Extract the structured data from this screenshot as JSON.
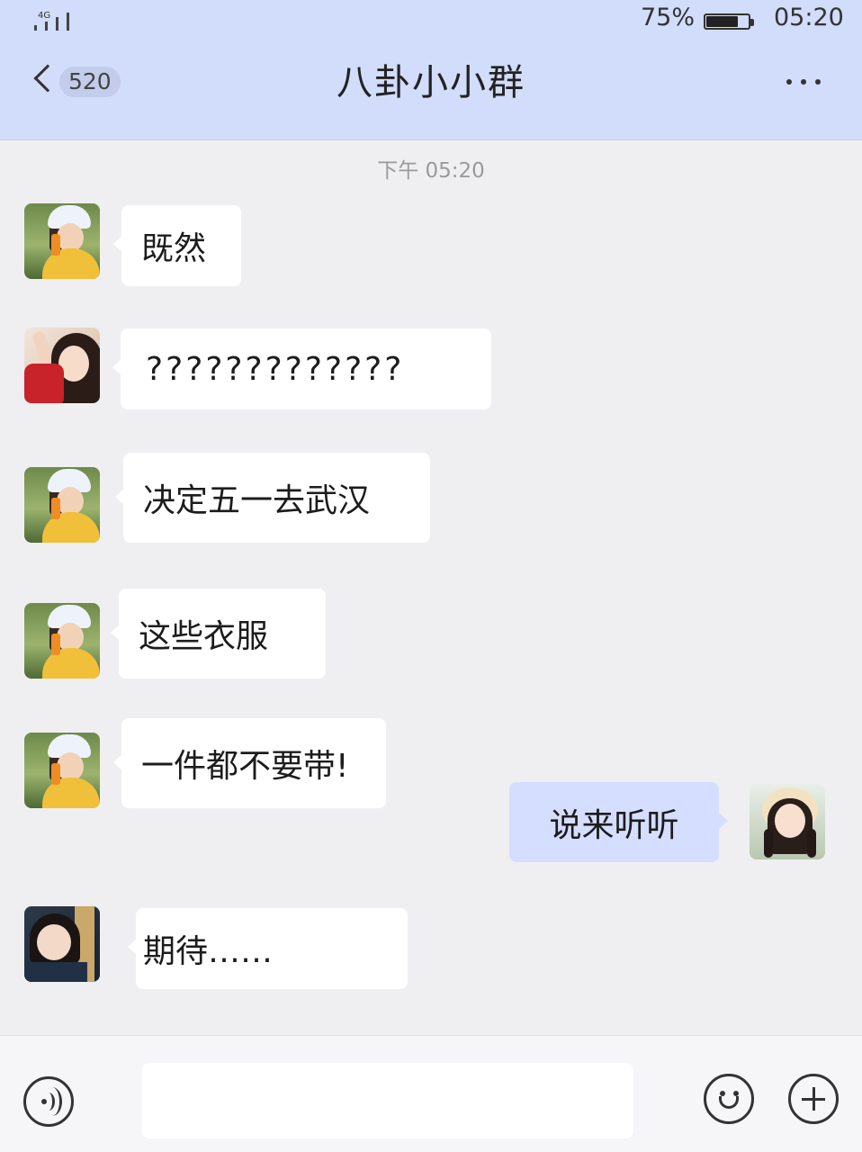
{
  "status_bar": {
    "network": "4G",
    "battery_percent": "75%",
    "battery_level": 0.75,
    "time": "05:20"
  },
  "header": {
    "back_count": "520",
    "title": "八卦小小群",
    "more_icon": "more-dots-icon"
  },
  "chat": {
    "timestamp": "下午 05:20",
    "messages": [
      {
        "sender": "other",
        "avatar": "girl-bucket-hat-avatar",
        "text": "既然"
      },
      {
        "sender": "other",
        "avatar": "girl-red-dress-avatar",
        "text": "?????????????"
      },
      {
        "sender": "other",
        "avatar": "girl-bucket-hat-avatar",
        "text": "决定五一去武汉"
      },
      {
        "sender": "other",
        "avatar": "girl-bucket-hat-avatar",
        "text": "这些衣服"
      },
      {
        "sender": "other",
        "avatar": "girl-bucket-hat-avatar",
        "text": "一件都不要带!"
      },
      {
        "sender": "self",
        "avatar": "girl-straw-hat-avatar",
        "text": "说来听听"
      },
      {
        "sender": "other",
        "avatar": "girl-short-hair-avatar",
        "text": "期待……"
      }
    ]
  },
  "input_bar": {
    "voice_icon": "voice-icon",
    "message_value": "",
    "emoji_icon": "emoji-icon",
    "plus_icon": "plus-icon"
  },
  "colors": {
    "header_bg": "#d2dcfb",
    "chat_bg": "#efeff1",
    "self_bubble": "#d6deff",
    "other_bubble": "#ffffff"
  }
}
